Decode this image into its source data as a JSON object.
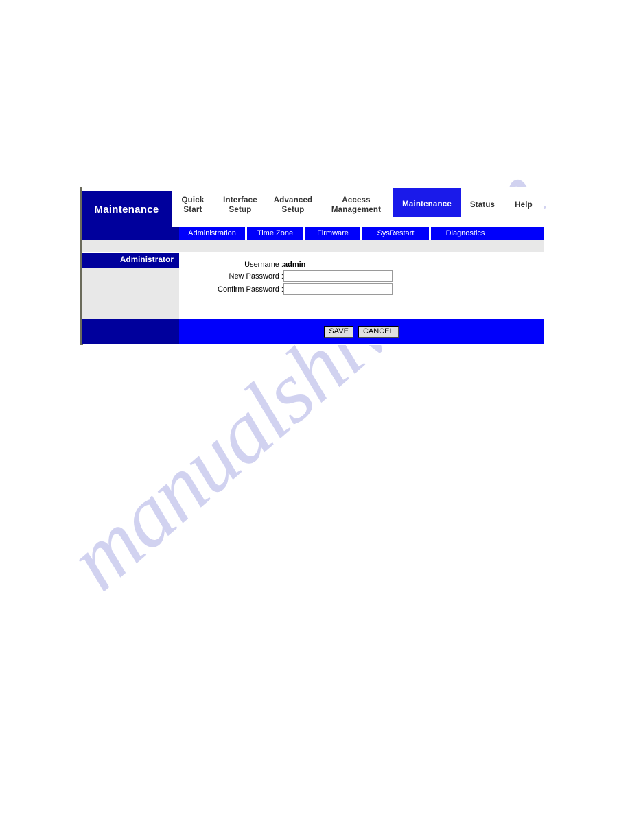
{
  "watermark": {
    "text": "manualshive.com"
  },
  "panel": {
    "title": "Maintenance",
    "main_tabs": [
      {
        "label_line1": "Quick",
        "label_line2": "Start",
        "active": false
      },
      {
        "label_line1": "Interface",
        "label_line2": "Setup",
        "active": false
      },
      {
        "label_line1": "Advanced",
        "label_line2": "Setup",
        "active": false
      },
      {
        "label_line1": "Access",
        "label_line2": "Management",
        "active": false
      },
      {
        "label_line1": "Maintenance",
        "label_line2": "",
        "active": true
      },
      {
        "label_line1": "Status",
        "label_line2": "",
        "active": false
      },
      {
        "label_line1": "Help",
        "label_line2": "",
        "active": false
      }
    ],
    "sub_tabs": [
      {
        "label": "Administration",
        "active": true
      },
      {
        "label": "Time Zone",
        "active": false
      },
      {
        "label": "Firmware",
        "active": false
      },
      {
        "label": "SysRestart",
        "active": false
      },
      {
        "label": "Diagnostics",
        "active": false
      }
    ],
    "sidebar": {
      "section_title": "Administrator"
    },
    "form": {
      "username_label": "Username :",
      "username_value": "admin",
      "new_password_label": "New Password :",
      "new_password_value": "",
      "confirm_password_label": "Confirm Password :",
      "confirm_password_value": ""
    },
    "footer": {
      "save_label": "SAVE",
      "cancel_label": "CANCEL"
    },
    "colors": {
      "navy": "#00009c",
      "bright_blue": "#0000fb",
      "active_tab_blue": "#1a1aea",
      "gray_strip": "#e8e8e8",
      "border": "#6b6b5b",
      "watermark": "#c9cbee"
    }
  }
}
